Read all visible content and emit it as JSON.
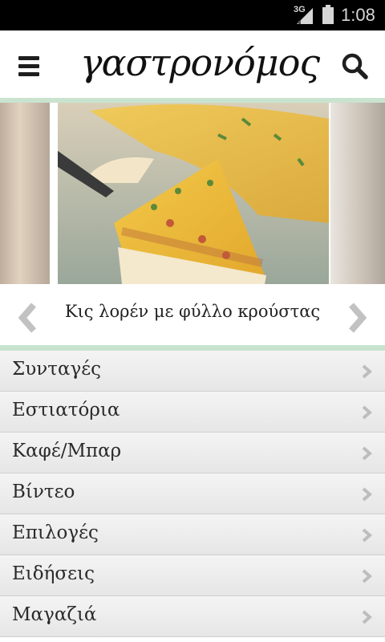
{
  "status_bar": {
    "network": "3G",
    "time": "1:08"
  },
  "header": {
    "logo_text": "γαστρονόμος",
    "menu_icon": "hamburger-icon",
    "search_icon": "search-icon"
  },
  "carousel": {
    "caption": "Κις λορέν με φύλλο κρούστας",
    "prev_icon": "chevron-left-icon",
    "next_icon": "chevron-right-icon"
  },
  "menu": {
    "items": [
      {
        "label": "Συνταγές"
      },
      {
        "label": "Εστιατόρια"
      },
      {
        "label": "Καφέ/Μπαρ"
      },
      {
        "label": "Βίντεο"
      },
      {
        "label": "Επιλογές"
      },
      {
        "label": "Ειδήσεις"
      },
      {
        "label": "Μαγαζιά"
      }
    ]
  },
  "colors": {
    "accent_line": "#c9e3cf",
    "status_bar": "#000000",
    "menu_bg": "#eeeeee"
  }
}
